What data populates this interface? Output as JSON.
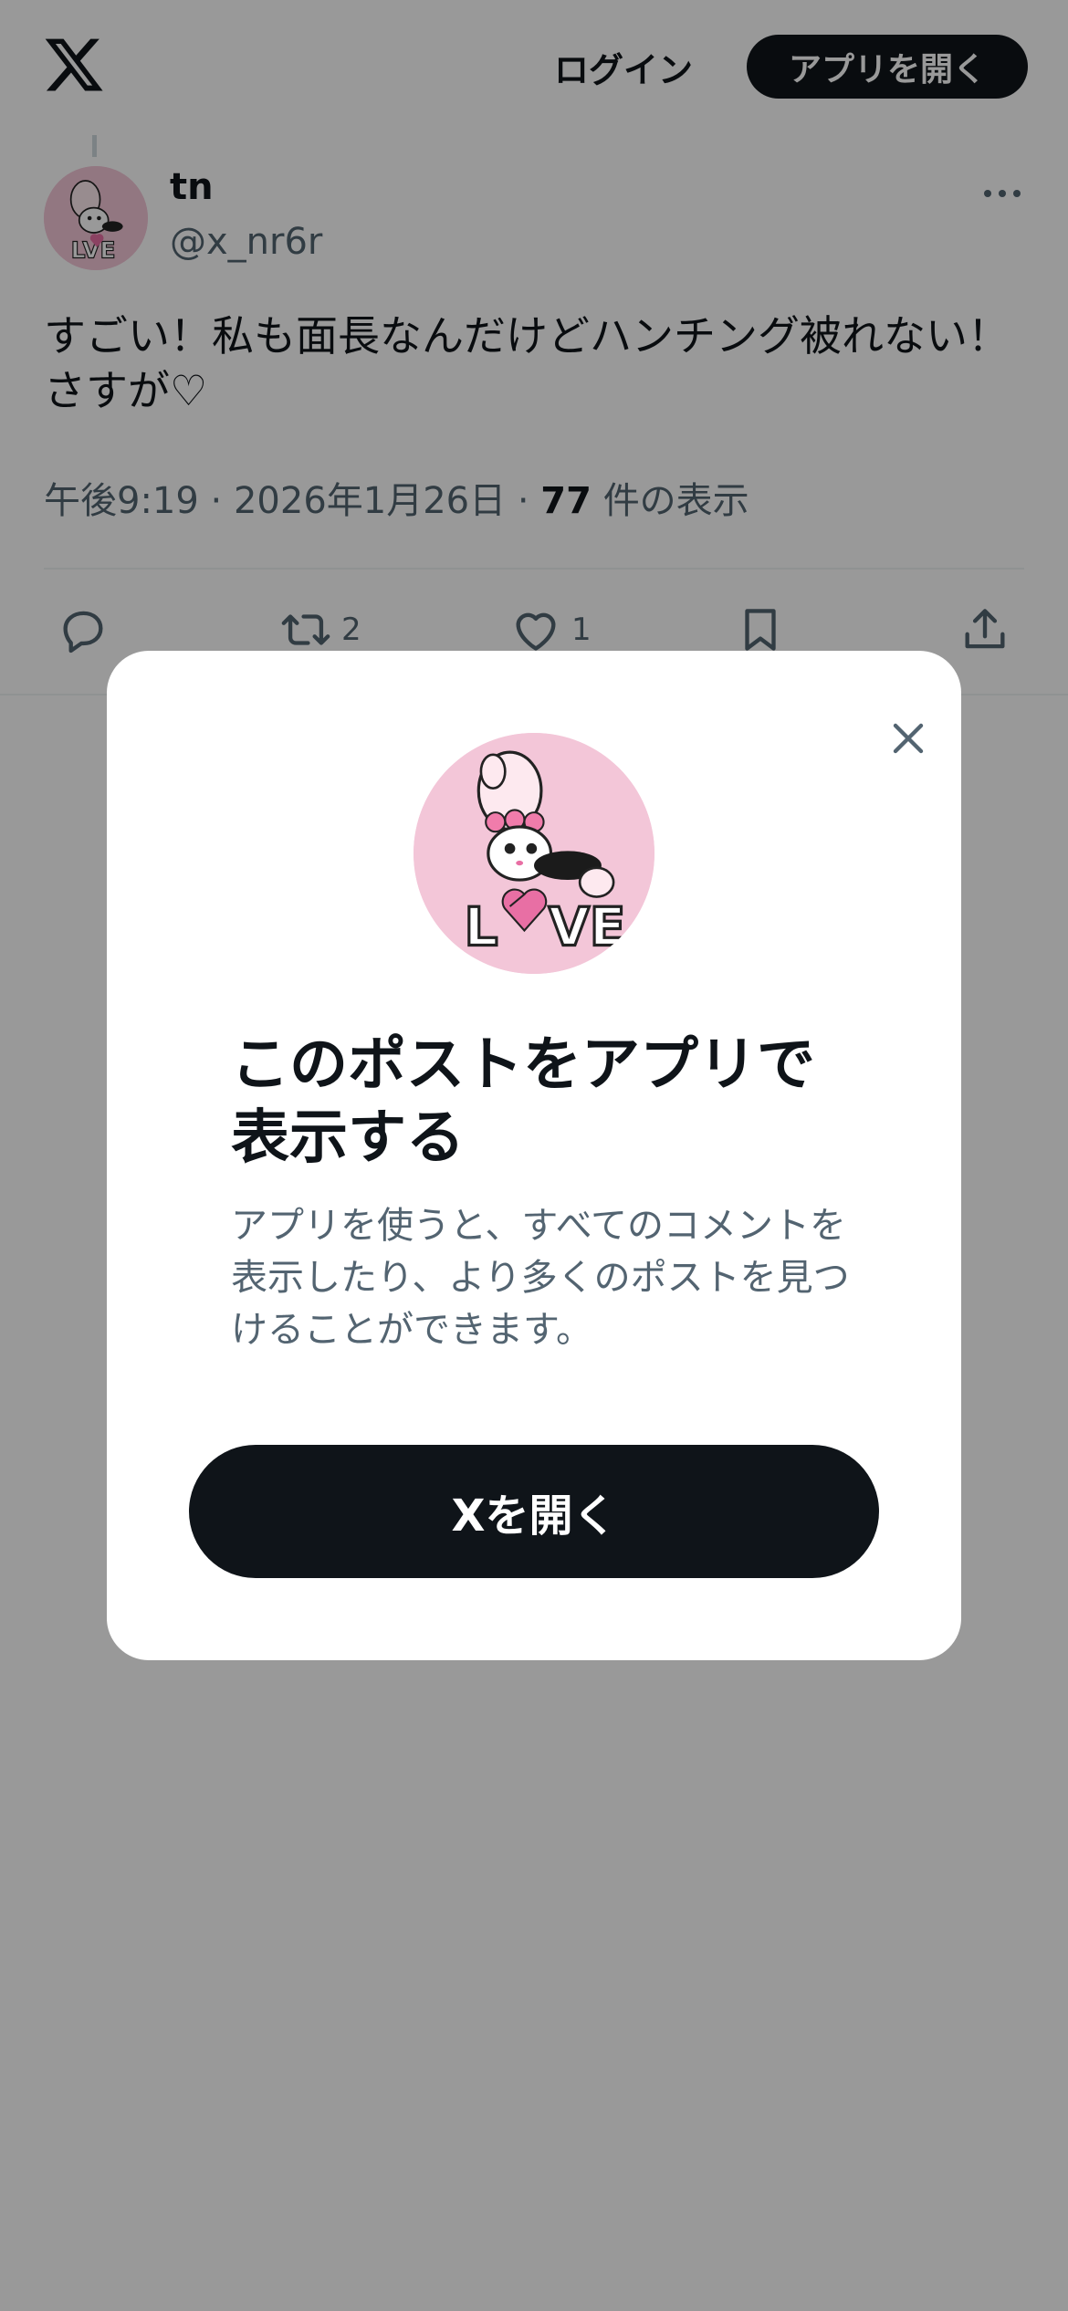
{
  "header": {
    "logo_icon": "x-logo-icon",
    "login_label": "ログイン",
    "open_app_label": "アプリを開く"
  },
  "post": {
    "author_name": "tn",
    "author_handle": "@x_nr6r",
    "text": "すごい！私も面長なんだけどハンチング被れない！さすが♡",
    "time": "午後9:19",
    "date": "2026年1月26日",
    "views_count": "77",
    "views_label": "件の表示",
    "retweet_count": "2",
    "like_count": "1"
  },
  "modal": {
    "title": "このポストをアプリで表示する",
    "description": "アプリを使うと、すべてのコメントを表示したり、より多くのポストを見つけることができます。",
    "cta_label": "Xを開く",
    "close_icon": "close-icon"
  },
  "colors": {
    "primary_text": "#0f1419",
    "secondary_text": "#536471",
    "avatar_bg": "#f3c6d8",
    "overlay": "rgba(0,0,0,0.4)"
  }
}
